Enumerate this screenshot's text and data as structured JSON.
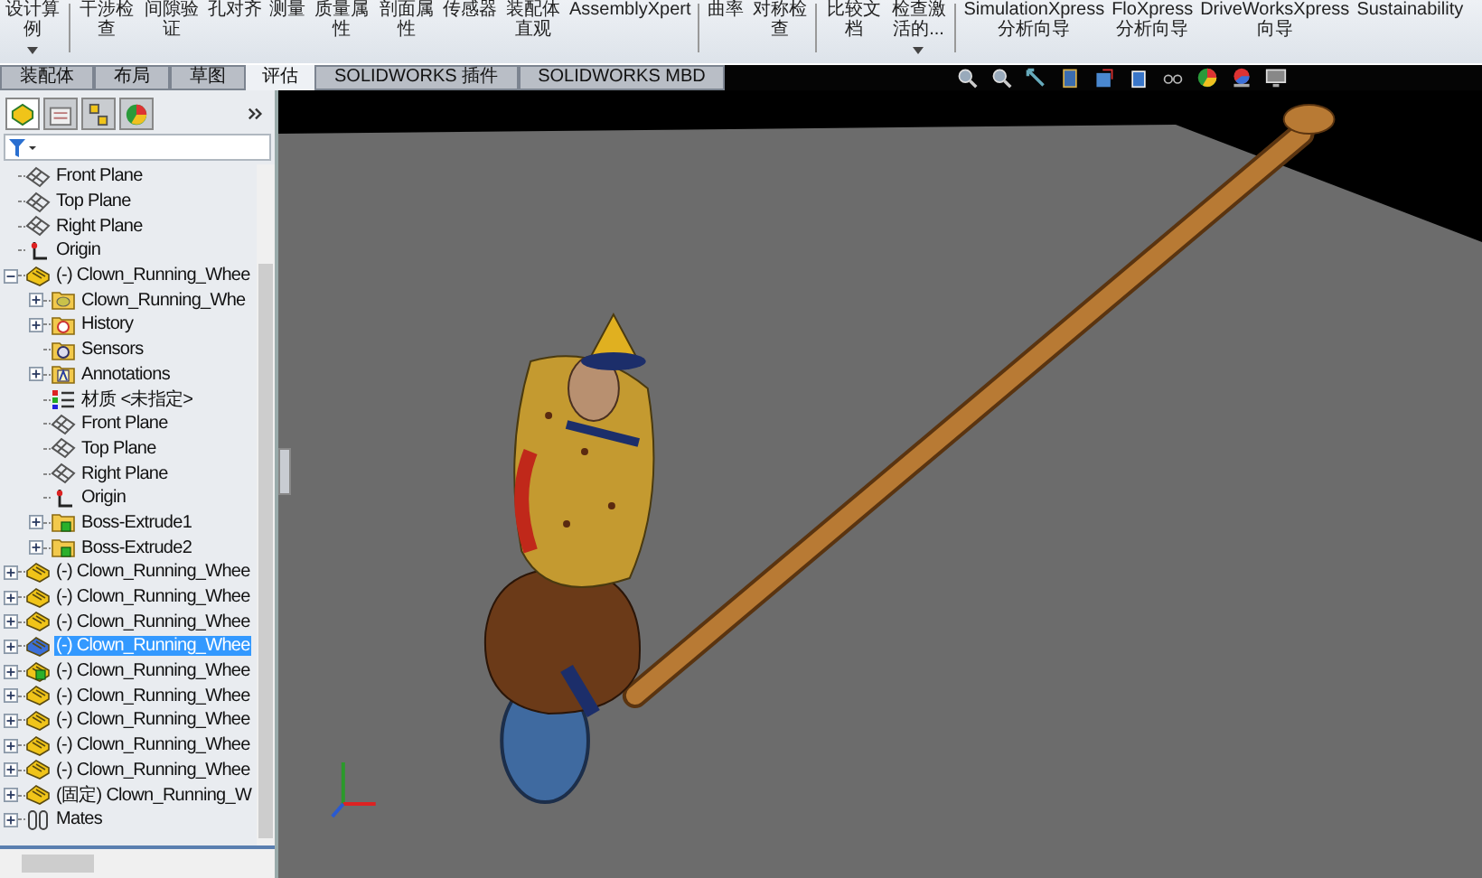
{
  "ribbon": {
    "groups": [
      [
        {
          "label": "设计算例",
          "dropdown": true
        }
      ],
      [
        {
          "label": "干涉检查",
          "dropdown": false
        },
        {
          "label": "间隙验证",
          "dropdown": false
        },
        {
          "label": "孔对齐",
          "dropdown": false
        },
        {
          "label": "测量",
          "dropdown": false
        },
        {
          "label": "质量属性",
          "dropdown": false
        },
        {
          "label": "剖面属性",
          "dropdown": false
        },
        {
          "label": "传感器",
          "dropdown": false
        },
        {
          "label": "装配体直观",
          "dropdown": false
        },
        {
          "label": "AssemblyXpert",
          "dropdown": false
        }
      ],
      [
        {
          "label": "曲率",
          "dropdown": false
        },
        {
          "label": "对称检查",
          "dropdown": false
        }
      ],
      [
        {
          "label": "比较文档",
          "dropdown": false
        },
        {
          "label": "检查激活的...",
          "dropdown": true
        }
      ],
      [
        {
          "label": "SimulationXpress 分析向导",
          "dropdown": false
        },
        {
          "label": "FloXpress 分析向导",
          "dropdown": false
        },
        {
          "label": "DriveWorksXpress 向导",
          "dropdown": false
        },
        {
          "label": "Sustainability",
          "dropdown": false
        }
      ]
    ]
  },
  "tabs": [
    {
      "label": "装配体",
      "selected": false
    },
    {
      "label": "布局",
      "selected": false
    },
    {
      "label": "草图",
      "selected": false
    },
    {
      "label": "评估",
      "selected": true
    },
    {
      "label": "SOLIDWORKS 插件",
      "selected": false
    },
    {
      "label": "SOLIDWORKS MBD",
      "selected": false
    }
  ],
  "panel_tabs": [
    {
      "kind": "feature-tree",
      "selected": true
    },
    {
      "kind": "property",
      "selected": false
    },
    {
      "kind": "configuration",
      "selected": false
    },
    {
      "kind": "appearance",
      "selected": false
    }
  ],
  "tree": [
    {
      "label": "Front Plane",
      "kind": "plane",
      "selected": false
    },
    {
      "label": "Top Plane",
      "kind": "plane",
      "selected": false
    },
    {
      "label": "Right Plane",
      "kind": "plane",
      "selected": false
    },
    {
      "label": "Origin",
      "kind": "origin",
      "selected": false
    },
    {
      "label": "(-) Clown_Running_Whee",
      "kind": "part",
      "selected": false,
      "expanded": true,
      "children": [
        {
          "label": "Clown_Running_Whe",
          "kind": "folder",
          "selected": false,
          "expanded": false
        },
        {
          "label": "History",
          "kind": "history",
          "selected": false,
          "expanded": false
        },
        {
          "label": "Sensors",
          "kind": "sensors",
          "selected": false
        },
        {
          "label": "Annotations",
          "kind": "annotations",
          "selected": false,
          "expanded": false
        },
        {
          "label": "材质 <未指定>",
          "kind": "material",
          "selected": false
        },
        {
          "label": "Front Plane",
          "kind": "plane",
          "selected": false
        },
        {
          "label": "Top Plane",
          "kind": "plane",
          "selected": false
        },
        {
          "label": "Right Plane",
          "kind": "plane",
          "selected": false
        },
        {
          "label": "Origin",
          "kind": "origin",
          "selected": false
        },
        {
          "label": "Boss-Extrude1",
          "kind": "feature",
          "selected": false,
          "expanded": false
        },
        {
          "label": "Boss-Extrude2",
          "kind": "feature",
          "selected": false,
          "expanded": false
        }
      ]
    },
    {
      "label": "(-) Clown_Running_Whee",
      "kind": "part",
      "selected": false,
      "expanded": false
    },
    {
      "label": "(-) Clown_Running_Whee",
      "kind": "part",
      "selected": false,
      "expanded": false
    },
    {
      "label": "(-) Clown_Running_Whee",
      "kind": "part",
      "selected": false,
      "expanded": false
    },
    {
      "label": "(-) Clown_Running_Whee",
      "kind": "part",
      "selected": true,
      "expanded": false
    },
    {
      "label": "(-) Clown_Running_Whee",
      "kind": "part-marked",
      "selected": false,
      "expanded": false
    },
    {
      "label": "(-) Clown_Running_Whee",
      "kind": "part",
      "selected": false,
      "expanded": false
    },
    {
      "label": "(-) Clown_Running_Whee",
      "kind": "part",
      "selected": false,
      "expanded": false
    },
    {
      "label": "(-) Clown_Running_Whee",
      "kind": "part",
      "selected": false,
      "expanded": false
    },
    {
      "label": "(-) Clown_Running_Whee",
      "kind": "part",
      "selected": false,
      "expanded": false
    },
    {
      "label": "(固定) Clown_Running_W",
      "kind": "part",
      "selected": false,
      "expanded": false
    },
    {
      "label": "Mates",
      "kind": "mates",
      "selected": false,
      "expanded": false
    }
  ]
}
